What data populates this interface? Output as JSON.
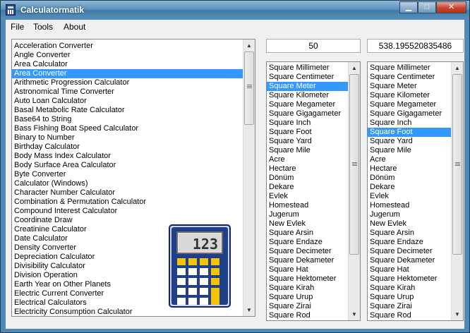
{
  "window": {
    "title": "Calculatormatik",
    "min_glyph": "▁",
    "max_glyph": "□",
    "close_glyph": "✕"
  },
  "menu": {
    "file": "File",
    "tools": "Tools",
    "about": "About"
  },
  "calculators": {
    "selected": "Area Converter",
    "items": [
      "Acceleration Converter",
      "Angle Converter",
      "Area Calculator",
      "Area Converter",
      "Arithmetic Progression Calculator",
      "Astronomical Time Converter",
      "Auto Loan Calculator",
      "Basal Metabolic Rate Calculator",
      "Base64 to String",
      "Bass Fishing Boat Speed Calculator",
      "Binary to Number",
      "Birthday Calculator",
      "Body Mass Index Calculator",
      "Body Surface Area Calculator",
      "Byte Converter",
      "Calculator (Windows)",
      "Character Number Calculator",
      "Combination & Permutation Calculator",
      "Compound Interest Calculator",
      "Coordinate Draw",
      "Creatinine Calculator",
      "Date Calculator",
      "Density Converter",
      "Depreciation Calculator",
      "Divisibility Calculator",
      "Division Operation",
      "Earth Year on Other Planets",
      "Electric Current Converter",
      "Electrical Calculators",
      "Electricity Consumption Calculator"
    ]
  },
  "converter": {
    "input_value": "50",
    "output_value": "538.195520835486",
    "from_selected": "Square Meter",
    "to_selected": "Square Foot",
    "units": [
      "Square Millimeter",
      "Square Centimeter",
      "Square Meter",
      "Square Kilometer",
      "Square Megameter",
      "Square Gigagameter",
      "Square Inch",
      "Square Foot",
      "Square Yard",
      "Square Mile",
      "Acre",
      "Hectare",
      "Dönüm",
      "Dekare",
      "Evlek",
      "Homestead",
      "Jugerum",
      "New Evlek",
      "Square Arsin",
      "Square Endaze",
      "Square Decimeter",
      "Square Dekameter",
      "Square Hat",
      "Square Hektometer",
      "Square Kirah",
      "Square Urup",
      "Square Zirai",
      "Square Rod"
    ]
  },
  "logo": {
    "display_text": "123"
  },
  "icons": {
    "scroll_up": "▲",
    "scroll_down": "▼"
  },
  "colors": {
    "selection": "#3399ff",
    "title_bar": "#5b92bd",
    "logo_navy": "#1f3f8a",
    "logo_key_yellow": "#f5c400"
  }
}
